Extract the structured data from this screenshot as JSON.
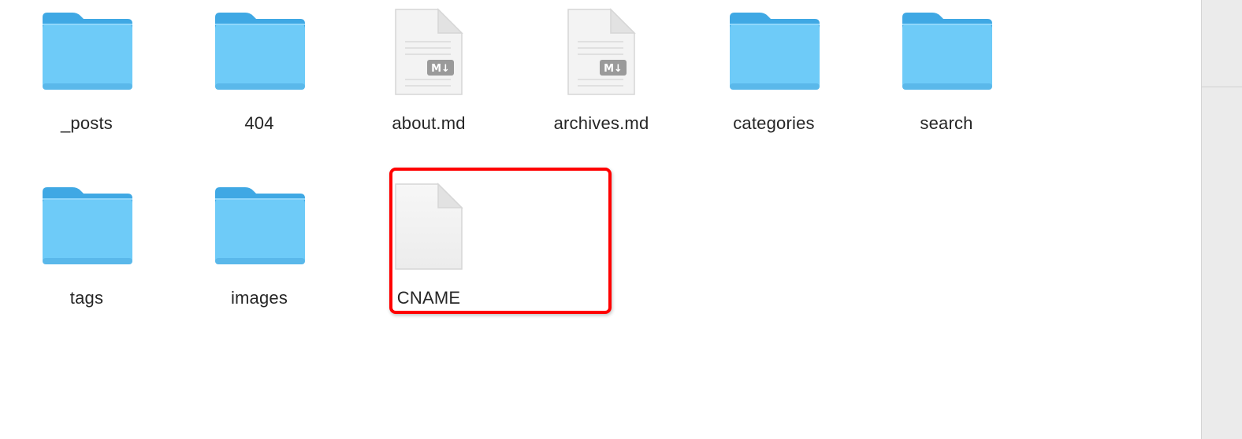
{
  "files": [
    {
      "name": "_posts",
      "kind": "folder"
    },
    {
      "name": "404",
      "kind": "folder"
    },
    {
      "name": "about.md",
      "kind": "markdown"
    },
    {
      "name": "archives.md",
      "kind": "markdown"
    },
    {
      "name": "categories",
      "kind": "folder"
    },
    {
      "name": "search",
      "kind": "folder"
    },
    {
      "name": "tags",
      "kind": "folder"
    },
    {
      "name": "images",
      "kind": "folder"
    },
    {
      "name": "CNAME",
      "kind": "file"
    }
  ],
  "markdown_badge": "M↓",
  "colors": {
    "folder_front": "#6ecbf8",
    "folder_back": "#3fa8e4",
    "highlight": "#ff0000",
    "label_text": "#262626"
  }
}
